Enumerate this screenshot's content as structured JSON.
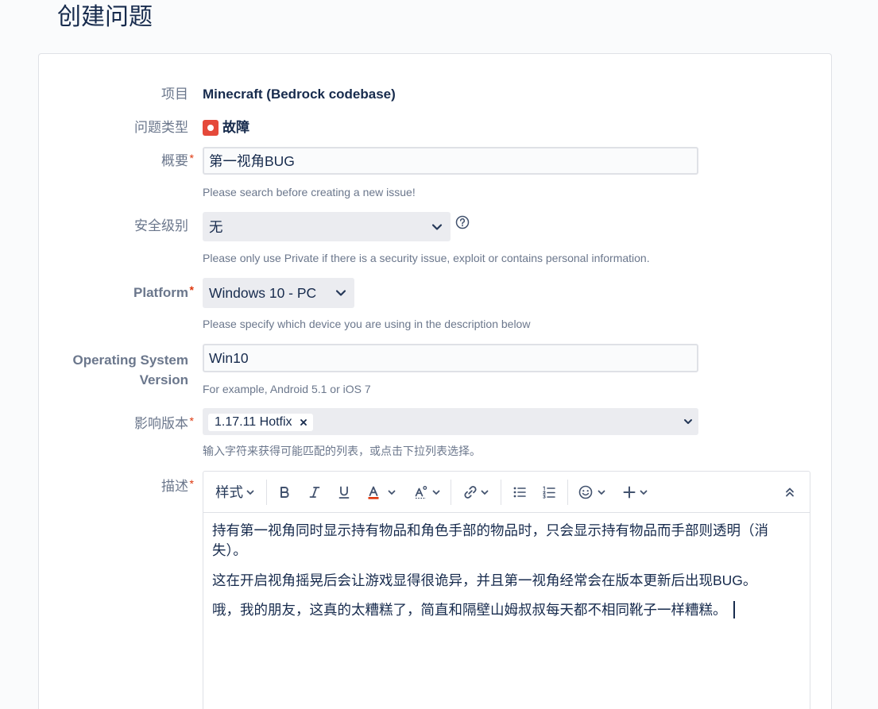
{
  "page": {
    "title": "创建问题"
  },
  "fields": {
    "project": {
      "label": "项目",
      "value": "Minecraft (Bedrock codebase)"
    },
    "issue_type": {
      "label": "问题类型",
      "value": "故障",
      "icon": "bug-icon"
    },
    "summary": {
      "label": "概要",
      "required_mark": "*",
      "value": "第一视角BUG",
      "help": "Please search before creating a new issue!"
    },
    "security_level": {
      "label": "安全级别",
      "selected": "无",
      "dropdown_icon": "chevron-down-icon",
      "help_icon": "question-circle-icon",
      "help": "Please only use Private if there is a security issue, exploit or contains personal information."
    },
    "platform": {
      "label": "Platform",
      "required_mark": "*",
      "selected": "Windows 10 - PC",
      "dropdown_icon": "chevron-down-icon",
      "help": "Please specify which device you are using in the description below"
    },
    "os_version": {
      "label": "Operating System Version",
      "value": "Win10",
      "help": "For example, Android 5.1 or iOS 7"
    },
    "affects_versions": {
      "label": "影响版本",
      "required_mark": "*",
      "chips": [
        {
          "label": "1.17.11 Hotfix",
          "remove_icon": "close-icon"
        }
      ],
      "dropdown_icon": "chevron-down-icon",
      "help": "输入字符来获得可能匹配的列表，或点击下拉列表选择。"
    },
    "description": {
      "label": "描述",
      "required_mark": "*",
      "toolbar": {
        "style_label": "样式",
        "icons": [
          "chevron-down-icon",
          "bold-icon",
          "italic-icon",
          "underline-icon",
          "text-color-icon",
          "more-formatting-icon",
          "link-icon",
          "bullet-list-icon",
          "numbered-list-icon",
          "emoji-icon",
          "plus-icon",
          "collapse-toolbar-icon"
        ]
      },
      "paragraphs": [
        "持有第一视角同时显示持有物品和角色手部的物品时，只会显示持有物品而手部则透明（消失）。",
        "这在开启视角摇晃后会让游戏显得很诡异，并且第一视角经常会在版本更新后出现BUG。",
        "哦，我的朋友，这真的太糟糕了，简直和隔壁山姆叔叔每天都不相同靴子一样糟糕。"
      ]
    }
  },
  "colors": {
    "text": "#172b4d",
    "label": "#6b778c",
    "required": "#de350b",
    "issue_type_bug": "#e5493a",
    "text_color_swatch": "#de350b",
    "toolbar_icon": "#42526e"
  }
}
